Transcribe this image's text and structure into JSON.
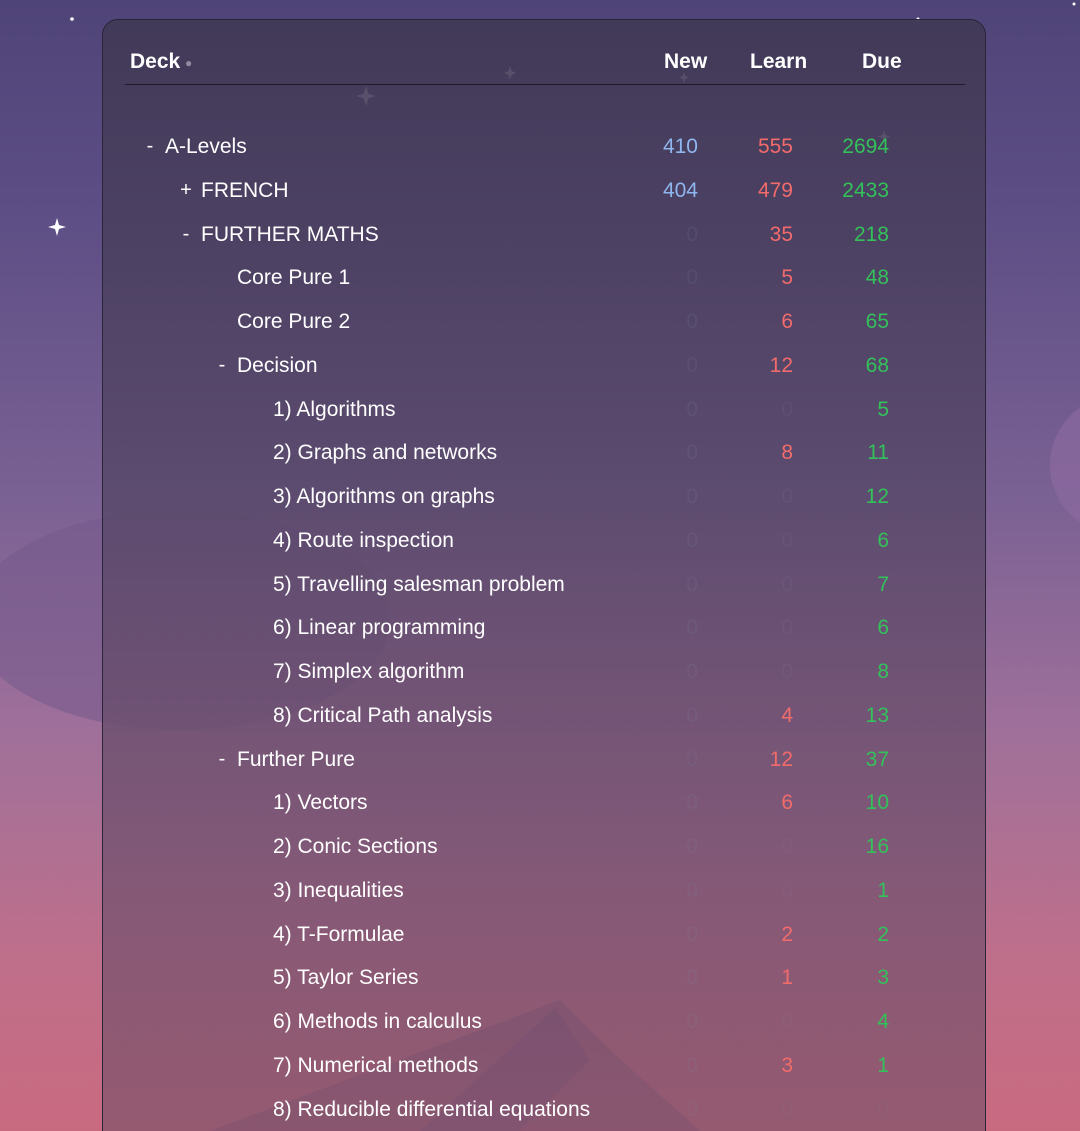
{
  "header": {
    "deck_label": "Deck",
    "new_label": "New",
    "learn_label": "Learn",
    "due_label": "Due"
  },
  "colors": {
    "new": "#8fb6ef",
    "learn": "#f26b6b",
    "due": "#33c15a"
  },
  "decks": [
    {
      "name": "A-Levels",
      "toggle": "-",
      "level": 0,
      "new": "410",
      "learn": "555",
      "due": "2694"
    },
    {
      "name": "FRENCH",
      "toggle": "+",
      "level": 1,
      "new": "404",
      "learn": "479",
      "due": "2433"
    },
    {
      "name": "FURTHER MATHS",
      "toggle": "-",
      "level": 1,
      "new": "0",
      "learn": "35",
      "due": "218"
    },
    {
      "name": "Core Pure 1",
      "toggle": "",
      "level": 2,
      "new": "0",
      "learn": "5",
      "due": "48"
    },
    {
      "name": "Core Pure 2",
      "toggle": "",
      "level": 2,
      "new": "0",
      "learn": "6",
      "due": "65"
    },
    {
      "name": "Decision",
      "toggle": "-",
      "level": 2,
      "new": "0",
      "learn": "12",
      "due": "68"
    },
    {
      "name": "1) Algorithms",
      "toggle": "",
      "level": 3,
      "new": "0",
      "learn": "0",
      "due": "5"
    },
    {
      "name": "2) Graphs and networks",
      "toggle": "",
      "level": 3,
      "new": "0",
      "learn": "8",
      "due": "11"
    },
    {
      "name": "3) Algorithms on graphs",
      "toggle": "",
      "level": 3,
      "new": "0",
      "learn": "0",
      "due": "12"
    },
    {
      "name": "4) Route inspection",
      "toggle": "",
      "level": 3,
      "new": "0",
      "learn": "0",
      "due": "6"
    },
    {
      "name": "5) Travelling salesman problem",
      "toggle": "",
      "level": 3,
      "new": "0",
      "learn": "0",
      "due": "7"
    },
    {
      "name": "6) Linear programming",
      "toggle": "",
      "level": 3,
      "new": "0",
      "learn": "0",
      "due": "6"
    },
    {
      "name": "7) Simplex algorithm",
      "toggle": "",
      "level": 3,
      "new": "0",
      "learn": "0",
      "due": "8"
    },
    {
      "name": "8) Critical Path analysis",
      "toggle": "",
      "level": 3,
      "new": "0",
      "learn": "4",
      "due": "13"
    },
    {
      "name": "Further Pure",
      "toggle": "-",
      "level": 2,
      "new": "0",
      "learn": "12",
      "due": "37"
    },
    {
      "name": "1) Vectors",
      "toggle": "",
      "level": 3,
      "new": "0",
      "learn": "6",
      "due": "10"
    },
    {
      "name": "2) Conic Sections",
      "toggle": "",
      "level": 3,
      "new": "0",
      "learn": "0",
      "due": "16"
    },
    {
      "name": "3) Inequalities",
      "toggle": "",
      "level": 3,
      "new": "0",
      "learn": "0",
      "due": "1"
    },
    {
      "name": "4) T-Formulae",
      "toggle": "",
      "level": 3,
      "new": "0",
      "learn": "2",
      "due": "2"
    },
    {
      "name": "5) Taylor Series",
      "toggle": "",
      "level": 3,
      "new": "0",
      "learn": "1",
      "due": "3"
    },
    {
      "name": "6) Methods in calculus",
      "toggle": "",
      "level": 3,
      "new": "0",
      "learn": "0",
      "due": "4"
    },
    {
      "name": "7) Numerical methods",
      "toggle": "",
      "level": 3,
      "new": "0",
      "learn": "3",
      "due": "1"
    },
    {
      "name": "8) Reducible differential equations",
      "toggle": "",
      "level": 3,
      "new": "0",
      "learn": "0",
      "due": "0"
    }
  ]
}
